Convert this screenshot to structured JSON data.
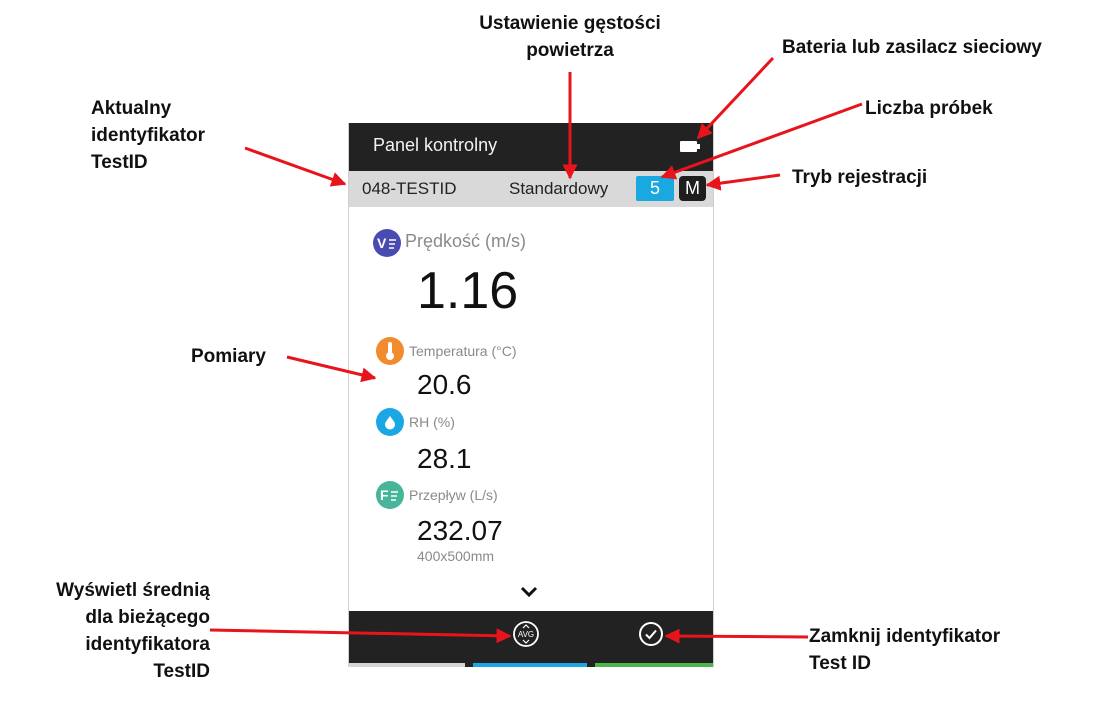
{
  "device": {
    "title": "Panel kontrolny",
    "test_id": "048-TESTID",
    "air_density": "Standardowy",
    "sample_count": "5",
    "log_mode": "M",
    "measurements": [
      {
        "icon": "velocity-icon",
        "icon_text": "V",
        "label": "Prędkość (m/s)",
        "value": "1.16",
        "color": "#4a4bb0"
      },
      {
        "icon": "thermometer-icon",
        "icon_text": "",
        "label": "Temperatura (°C)",
        "value": "20.6",
        "color": "#f28a2e"
      },
      {
        "icon": "droplet-icon",
        "icon_text": "",
        "label": "RH (%)",
        "value": "28.1",
        "color": "#1ba7e3"
      },
      {
        "icon": "flow-icon",
        "icon_text": "F",
        "label": "Przepływ (L/s)",
        "value": "232.07",
        "sub": "400x500mm",
        "color": "#46b59a"
      }
    ],
    "avg_label": "AVG",
    "colors": {
      "title_bar": "#222222",
      "status_bar": "#d9d9d9",
      "samples_badge": "#19a8e0",
      "tab_gray": "#d6d6d6",
      "tab_blue": "#1ba7e3",
      "tab_green": "#4cb84a"
    }
  },
  "annotations": {
    "air_density": [
      "Ustawienie gęstości",
      "powietrza"
    ],
    "battery": "Bateria lub zasilacz sieciowy",
    "test_id": [
      "Aktualny",
      "identyfikator",
      "TestID"
    ],
    "samples": "Liczba próbek",
    "mode": "Tryb rejestracji",
    "measurements": "Pomiary",
    "average": [
      "Wyświetl średnią",
      "dla bieżącego",
      "identyfikatora",
      "TestID"
    ],
    "close": [
      "Zamknij identyfikator",
      "Test ID"
    ],
    "arrow_color": "#e8141c"
  }
}
